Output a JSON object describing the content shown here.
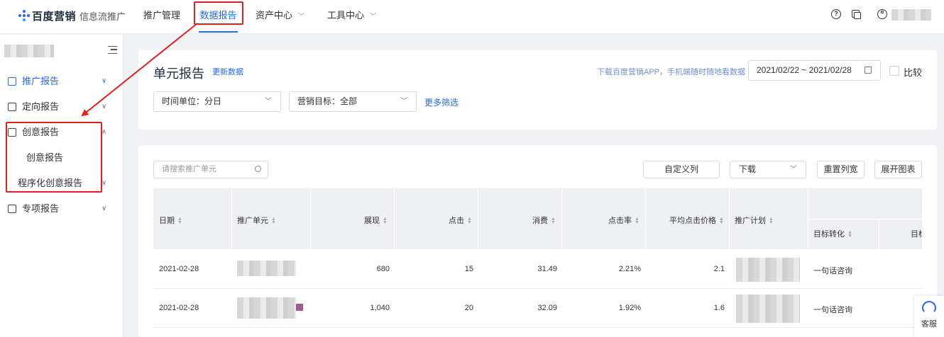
{
  "header": {
    "brand": "百度营销",
    "product": "信息流推广",
    "nav": [
      {
        "label": "推广管理"
      },
      {
        "label": "数据报告"
      },
      {
        "label": "资产中心"
      },
      {
        "label": "工具中心"
      }
    ],
    "help_glyph": "?"
  },
  "sidebar": {
    "items": [
      {
        "label": "推广报告"
      },
      {
        "label": "定向报告"
      },
      {
        "label": "创意报告"
      },
      {
        "label": "创意报告"
      },
      {
        "label": "程序化创意报告"
      },
      {
        "label": "专项报告"
      }
    ]
  },
  "filters": {
    "title": "单元报告",
    "refresh": "更新数据",
    "app_tip": "下载百度营销APP，手机端随时随地看数据",
    "date_range": "2021/02/22 ~ 2021/02/28",
    "compare": "比较",
    "time_unit": "时间单位：分日",
    "goal": "营销目标：全部",
    "more": "更多筛选"
  },
  "toolbar": {
    "search_placeholder": "请搜索推广单元",
    "custom_columns": "自定义列",
    "download": "下载",
    "reset_width": "重置列宽",
    "expand_chart": "展开图表"
  },
  "table": {
    "columns": [
      "日期",
      "推广单元",
      "展现",
      "点击",
      "消费",
      "点击率",
      "平均点击价格",
      "推广计划",
      "目标转化",
      "目标"
    ],
    "rows": [
      {
        "date": "2021-02-28",
        "impressions": "680",
        "clicks": "15",
        "cost": "31.49",
        "ctr": "2.21%",
        "cpc": "2.1",
        "goal": "一句话咨询"
      },
      {
        "date": "2021-02-28",
        "impressions": "1,040",
        "clicks": "20",
        "cost": "32.09",
        "ctr": "1.92%",
        "cpc": "1.6",
        "goal": "一句话咨询"
      }
    ]
  },
  "service": {
    "label": "客服"
  },
  "colors": {
    "accent": "#2468f2",
    "annotation": "#e02020"
  }
}
